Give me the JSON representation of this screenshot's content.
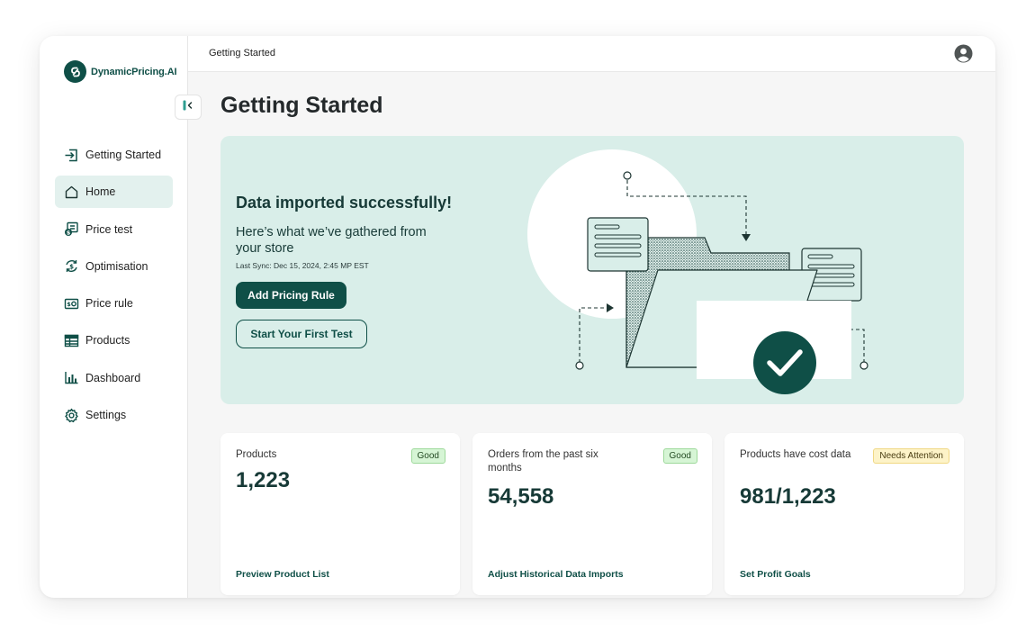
{
  "app": {
    "name": "DynamicPricing.AI"
  },
  "topbar": {
    "breadcrumb": "Getting Started"
  },
  "page": {
    "title": "Getting Started"
  },
  "sidebar": {
    "items": [
      {
        "label": "Getting Started",
        "icon": "sign-in-icon",
        "active": false
      },
      {
        "label": "Home",
        "icon": "home-icon",
        "active": true
      },
      {
        "label": "Price test",
        "icon": "price-test-icon",
        "active": false
      },
      {
        "label": "Optimisation",
        "icon": "optimisation-icon",
        "active": false
      },
      {
        "label": "Price rule",
        "icon": "price-rule-icon",
        "active": false
      },
      {
        "label": "Products",
        "icon": "table-icon",
        "active": false
      },
      {
        "label": "Dashboard",
        "icon": "chart-icon",
        "active": false
      },
      {
        "label": "Settings",
        "icon": "gear-icon",
        "active": false
      }
    ]
  },
  "hero": {
    "title": "Data imported successfully!",
    "subtitle": "Here’s what we’ve gathered from your store",
    "last_sync": "Last Sync: Dec 15, 2024, 2:45 MP EST",
    "primary_button": "Add Pricing Rule",
    "secondary_button": "Start Your First Test"
  },
  "cards": [
    {
      "label": "Products",
      "value": "1,223",
      "badge": "Good",
      "badge_type": "good",
      "link": "Preview Product List"
    },
    {
      "label": "Orders from the past six months",
      "value": "54,558",
      "badge": "Good",
      "badge_type": "good",
      "link": "Adjust Historical Data Imports"
    },
    {
      "label": "Products have cost data",
      "value": "981/1,223",
      "badge": "Needs Attention",
      "badge_type": "warn",
      "link": "Set Profit Goals"
    }
  ],
  "colors": {
    "brand": "#0f4f47",
    "hero_bg": "#d9eee9",
    "active_nav_bg": "#e3f1ee",
    "badge_good": "#d6f5d5",
    "badge_warn": "#fdf3c8"
  }
}
